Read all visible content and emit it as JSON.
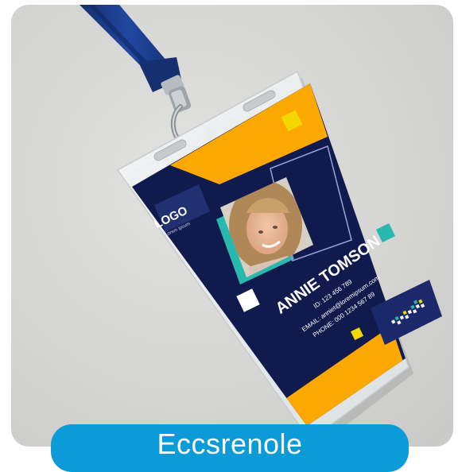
{
  "badge": {
    "logo_text": "LOGO",
    "logo_sub": "Lorem ipsum",
    "name": "ANNIE TOMSON",
    "id_line": "ID: 123 456 789",
    "email_line": "EMAIL: anniet@loremipsum.com",
    "phone_line": "PHONE: 000 1234 567 89"
  },
  "caption": {
    "label": "Eccsrenole"
  },
  "colors": {
    "navy": "#101a4d",
    "orange": "#fca800",
    "teal": "#28b8ad",
    "yellow": "#f2d800",
    "lanyard": "#1c3d8c",
    "caption_bg": "#0b9bd8"
  }
}
